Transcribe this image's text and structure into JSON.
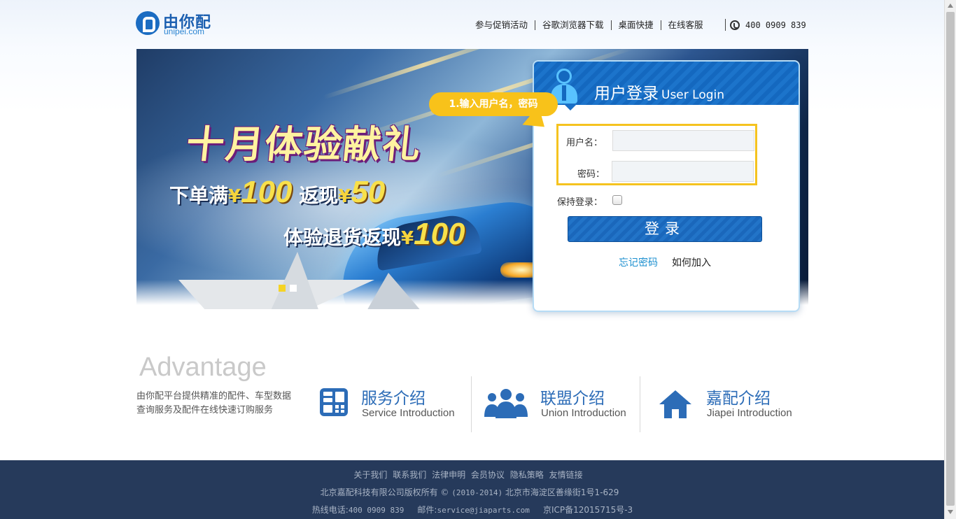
{
  "header": {
    "logo_text": "由你配",
    "logo_sub": "unipei.com",
    "nav": [
      "参与促销活动",
      "谷歌浏览器下载",
      "桌面快捷",
      "在线客服"
    ],
    "phone": "400 0909 839"
  },
  "banner": {
    "headline": "十月体验献礼",
    "promo1_prefix": "下单满",
    "promo1_yen1": "¥",
    "promo1_amount1": "100",
    "promo1_mid": "返现",
    "promo1_yen2": "¥",
    "promo1_amount2": "50",
    "promo2_prefix": "体验退货返现",
    "promo2_yen": "¥",
    "promo2_amount": "100",
    "slide_count": 2,
    "active_slide": 1
  },
  "callout": {
    "text": "1.输入用户名，密码"
  },
  "login": {
    "title": "用户登录",
    "title_en": "User Login",
    "username_label": "用户名：",
    "username_value": "",
    "password_label": "密码：",
    "password_value": "",
    "remember_label": "保持登录：",
    "remember_checked": false,
    "submit_label": "登录",
    "forgot_label": "忘记密码",
    "join_label": "如何加入"
  },
  "advantage": {
    "title": "Advantage",
    "description": "由你配平台提供精准的配件、车型数据查询服务及配件在线快速订购服务",
    "features": [
      {
        "title": "服务介绍",
        "subtitle": "Service Introduction",
        "icon": "calculator-icon"
      },
      {
        "title": "联盟介绍",
        "subtitle": "Union Introduction",
        "icon": "people-group-icon"
      },
      {
        "title": "嘉配介绍",
        "subtitle": "Jiapei Introduction",
        "icon": "home-icon"
      }
    ]
  },
  "footer": {
    "links": [
      "关于我们",
      "联系我们",
      "法律申明",
      "会员协议",
      "隐私策略",
      "友情链接"
    ],
    "copyright_company": "北京嘉配科技有限公司版权所有",
    "copyright_symbol": "©",
    "copyright_years": "(2010-2014)",
    "copyright_address": "北京市海淀区善缘街1号1-629",
    "hotline_label": "热线电话:",
    "hotline": "400 0909 839",
    "email_label": "邮件:",
    "email": "service@jiaparts.com",
    "icp": "京ICP备12015715号-3"
  },
  "colors": {
    "brand_blue": "#1b6cc2",
    "highlight_yellow": "#f8c21a",
    "footer_bg": "#263a5b"
  }
}
